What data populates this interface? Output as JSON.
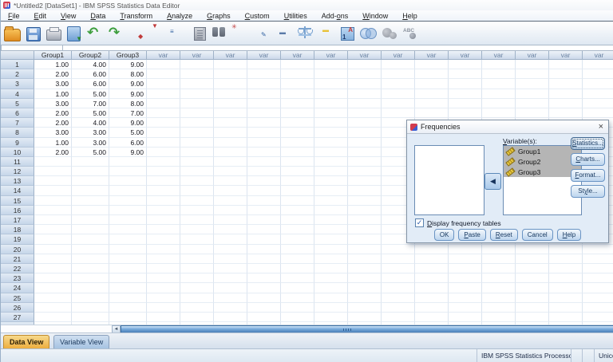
{
  "window": {
    "title": "*Untitled2 [DataSet1] - IBM SPSS Statistics Data Editor"
  },
  "menu": {
    "items": [
      {
        "label": "File",
        "u": 0
      },
      {
        "label": "Edit",
        "u": 0
      },
      {
        "label": "View",
        "u": 0
      },
      {
        "label": "Data",
        "u": 0
      },
      {
        "label": "Transform",
        "u": 0
      },
      {
        "label": "Analyze",
        "u": 0
      },
      {
        "label": "Graphs",
        "u": 0
      },
      {
        "label": "Custom",
        "u": 0
      },
      {
        "label": "Utilities",
        "u": 0
      },
      {
        "label": "Add-ons",
        "u": 4
      },
      {
        "label": "Window",
        "u": 0
      },
      {
        "label": "Help",
        "u": 0
      }
    ]
  },
  "toolbar": {
    "icons": [
      {
        "name": "open-data-icon",
        "type": "folder"
      },
      {
        "name": "save-icon",
        "type": "save"
      },
      {
        "name": "print-icon",
        "type": "print"
      },
      {
        "name": "recall-dialogs-icon",
        "type": "recall"
      },
      {
        "name": "undo-icon",
        "type": "undo"
      },
      {
        "name": "redo-icon",
        "type": "redo"
      },
      {
        "name": "goto-case-icon",
        "type": "grid",
        "mark": "◆",
        "mc": "#c03a3a",
        "mx": 11,
        "my": 10
      },
      {
        "name": "goto-variable-icon",
        "type": "grid",
        "mark": "▼",
        "mc": "#c03a3a",
        "mx": 1,
        "my": -3
      },
      {
        "name": "variable-list-icon",
        "type": "grid",
        "mark": "≡",
        "mc": "#2e5fa0",
        "mx": -3,
        "my": 4
      },
      {
        "name": "variables-icon",
        "type": "building",
        "mark": "",
        "mc": "",
        "mx": 0,
        "my": 0
      },
      {
        "name": "find-icon",
        "type": "binoc",
        "mark": "",
        "mc": "",
        "mx": 0,
        "my": 0
      },
      {
        "name": "insert-cases-icon",
        "type": "grid",
        "mark": "✳",
        "mc": "#c03a3a",
        "mx": -2,
        "my": -2
      },
      {
        "name": "insert-variable-icon",
        "type": "grid",
        "mark": "✎",
        "mc": "#2e5fa0",
        "mx": 8,
        "my": 8
      },
      {
        "name": "split-file-icon",
        "type": "grid",
        "mark": "▬",
        "mc": "#5a7aa8",
        "mx": 4,
        "my": 5
      },
      {
        "name": "weight-cases-icon",
        "type": "scale",
        "mark": "",
        "mc": "",
        "mx": 0,
        "my": 0
      },
      {
        "name": "select-cases-icon",
        "type": "grid",
        "mark": "▬",
        "mc": "#e8c23a",
        "mx": 4,
        "my": 2
      },
      {
        "name": "value-labels-icon",
        "type": "labels",
        "mark": "",
        "mc": "",
        "mx": 0,
        "my": 0
      },
      {
        "name": "use-variable-sets-icon",
        "type": "venn",
        "mark": "",
        "mc": "",
        "mx": 0,
        "my": 0
      },
      {
        "name": "show-all-variables-icon",
        "type": "circles",
        "mark": "",
        "mc": "",
        "mx": 0,
        "my": 0
      },
      {
        "name": "spell-check-icon",
        "type": "abc",
        "mark": "",
        "mc": "",
        "mx": 0,
        "my": 0
      }
    ]
  },
  "grid": {
    "columns": [
      "Group1",
      "Group2",
      "Group3"
    ],
    "var_label": "var",
    "var_column_count": 14,
    "visible_row_count": 28,
    "rows": [
      [
        "1.00",
        "4.00",
        "9.00"
      ],
      [
        "2.00",
        "6.00",
        "8.00"
      ],
      [
        "3.00",
        "6.00",
        "9.00"
      ],
      [
        "1.00",
        "5.00",
        "9.00"
      ],
      [
        "3.00",
        "7.00",
        "8.00"
      ],
      [
        "2.00",
        "5.00",
        "7.00"
      ],
      [
        "2.00",
        "4.00",
        "9.00"
      ],
      [
        "3.00",
        "3.00",
        "5.00"
      ],
      [
        "1.00",
        "3.00",
        "6.00"
      ],
      [
        "2.00",
        "5.00",
        "9.00"
      ]
    ]
  },
  "dialog": {
    "title": "Frequencies",
    "close_glyph": "×",
    "variables_label": {
      "label": "Variable(s):",
      "u": 0
    },
    "variables": [
      "Group1",
      "Group2",
      "Group3"
    ],
    "arrow_glyph": "◀",
    "side_buttons": [
      {
        "label": "Statistics...",
        "u": 0,
        "focused": true
      },
      {
        "label": "Charts...",
        "u": 0,
        "focused": false
      },
      {
        "label": "Format...",
        "u": 0,
        "focused": false
      },
      {
        "label": "Style...",
        "u": 2,
        "focused": false
      }
    ],
    "checkbox": {
      "label": "Display frequency tables",
      "u": 0,
      "checked": true,
      "check_glyph": "✓"
    },
    "bottom_buttons": [
      {
        "label": "OK",
        "u": -1
      },
      {
        "label": "Paste",
        "u": 0
      },
      {
        "label": "Reset",
        "u": 0
      },
      {
        "label": "Cancel",
        "u": -1
      },
      {
        "label": "Help",
        "u": 0
      }
    ]
  },
  "tabs": {
    "data_view": "Data View",
    "variable_view": "Variable View"
  },
  "status": {
    "processor": "IBM SPSS Statistics Processor is ready",
    "unicode": "Unicode:ON"
  },
  "scrollbar": {
    "left_arrow_glyph": "◄"
  },
  "colors": {
    "selection_gray": "#b5b5b5",
    "active_tab_orange": "#edad3e",
    "scrollbar_blue": "#79abdc",
    "accent_blue": "#4a7ebb",
    "grid_line": "#dce5f0"
  }
}
